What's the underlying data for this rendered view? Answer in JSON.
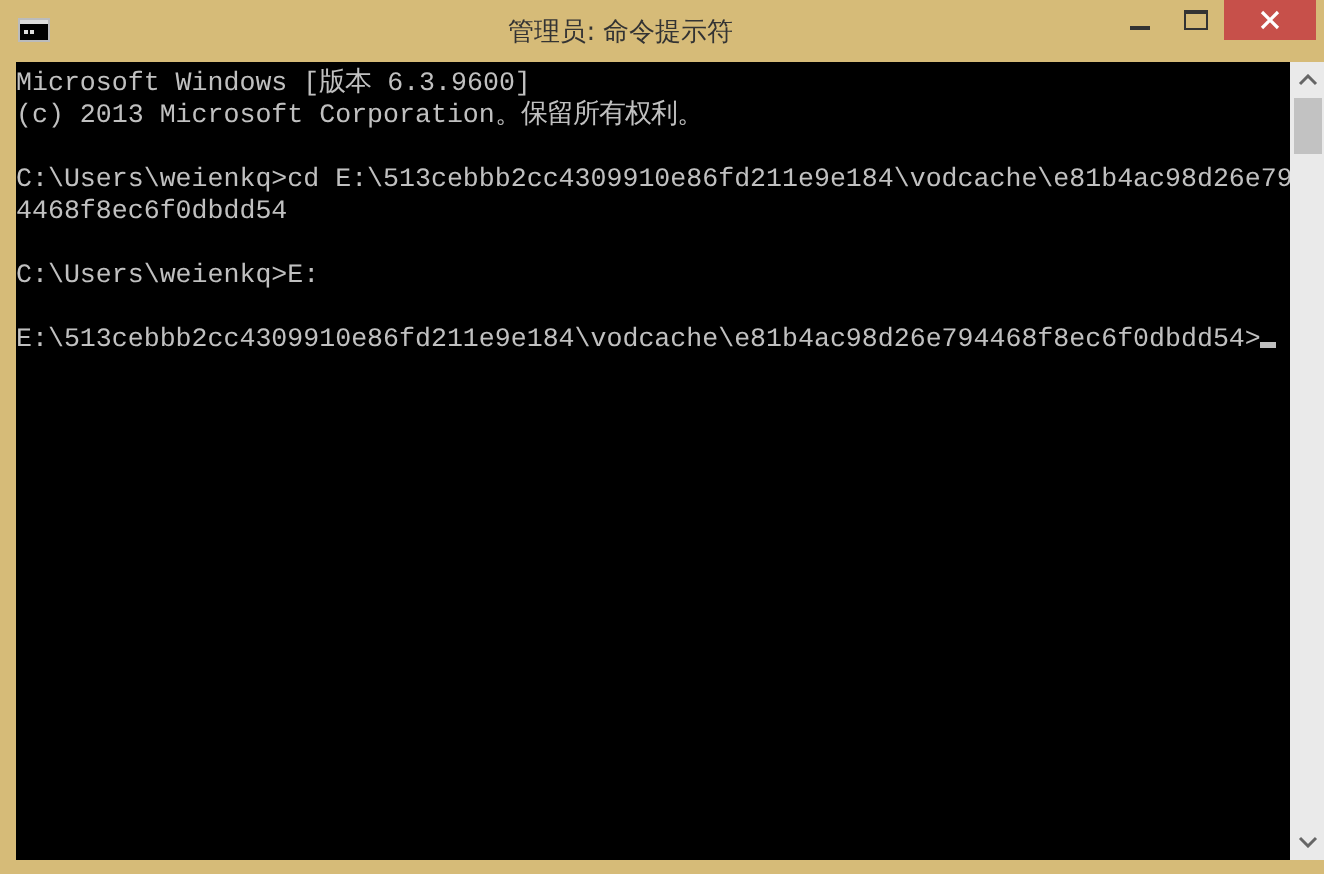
{
  "window": {
    "title": "管理员: 命令提示符"
  },
  "console": {
    "blocks": [
      {
        "lines": [
          "Microsoft Windows [版本 6.3.9600]",
          "(c) 2013 Microsoft Corporation。保留所有权利。"
        ]
      },
      {
        "lines": [
          "C:\\Users\\weienkq>cd E:\\513cebbb2cc4309910e86fd211e9e184\\vodcache\\e81b4ac98d26e79",
          "4468f8ec6f0dbdd54"
        ]
      },
      {
        "lines": [
          "C:\\Users\\weienkq>E:"
        ]
      },
      {
        "lines": [
          "E:\\513cebbb2cc4309910e86fd211e9e184\\vodcache\\e81b4ac98d26e794468f8ec6f0dbdd54>"
        ]
      }
    ]
  }
}
